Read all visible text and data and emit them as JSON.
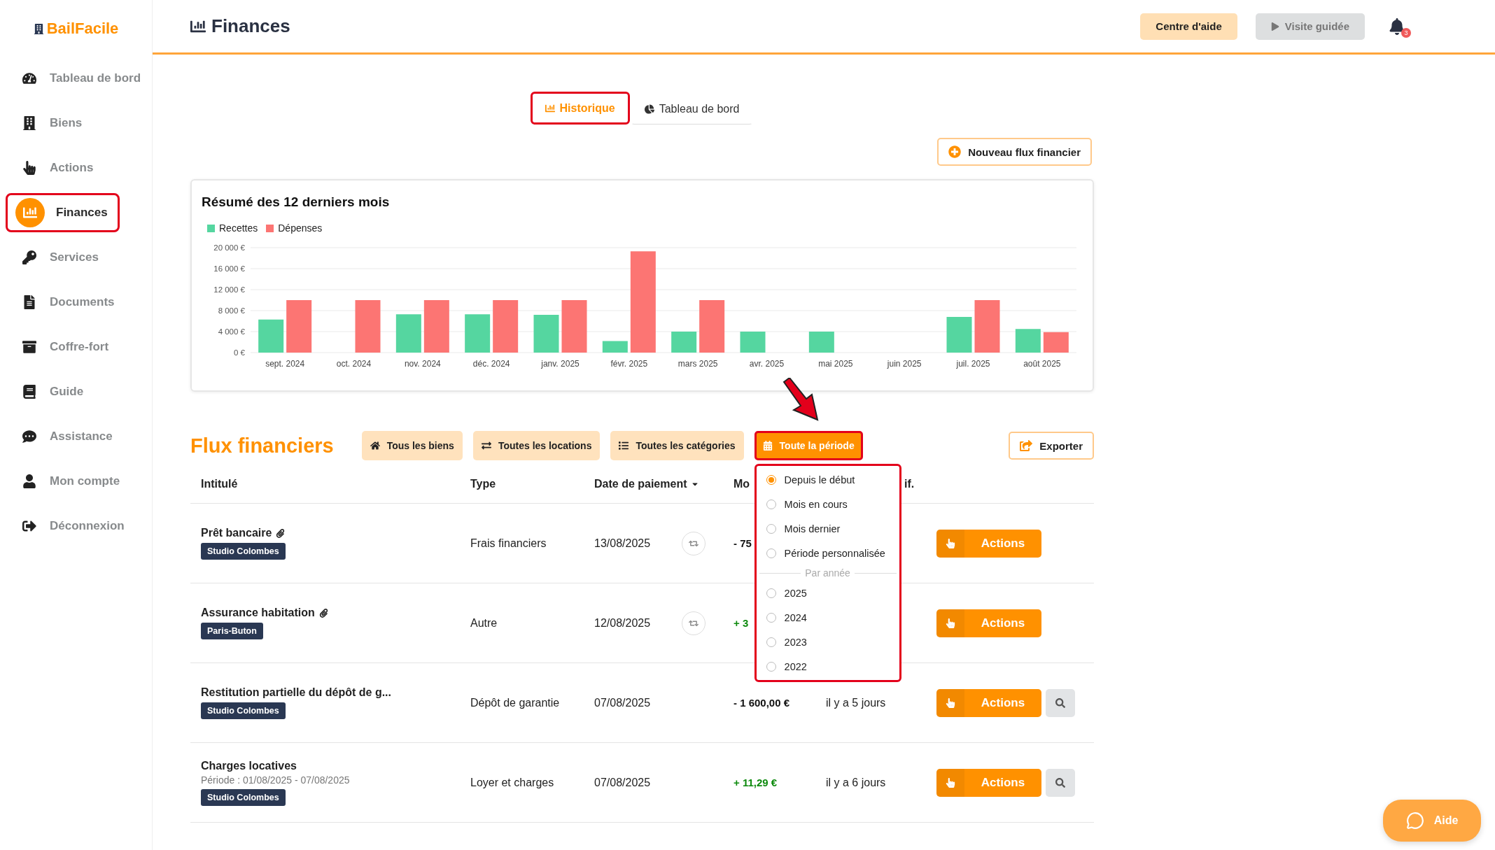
{
  "brand": "BailFacile",
  "sidebar": {
    "items": [
      {
        "label": "Tableau de bord",
        "selected": false,
        "highlighted": false
      },
      {
        "label": "Biens",
        "selected": false,
        "highlighted": false
      },
      {
        "label": "Actions",
        "selected": false,
        "highlighted": false
      },
      {
        "label": "Finances",
        "selected": true,
        "highlighted": true
      },
      {
        "label": "Services",
        "selected": false,
        "highlighted": false
      },
      {
        "label": "Documents",
        "selected": false,
        "highlighted": false
      },
      {
        "label": "Coffre-fort",
        "selected": false,
        "highlighted": false
      },
      {
        "label": "Guide",
        "selected": false,
        "highlighted": false
      },
      {
        "label": "Assistance",
        "selected": false,
        "highlighted": false
      },
      {
        "label": "Mon compte",
        "selected": false,
        "highlighted": false
      },
      {
        "label": "Déconnexion",
        "selected": false,
        "highlighted": false
      }
    ]
  },
  "header": {
    "title": "Finances",
    "buttons": [
      {
        "label": "Centre d'aide",
        "kind": "help"
      },
      {
        "label": "Visite guidée",
        "kind": "tour"
      }
    ],
    "notifications": "3"
  },
  "tabs": [
    {
      "label": "Historique",
      "selected": true,
      "highlighted": true
    },
    {
      "label": "Tableau de bord",
      "selected": false,
      "highlighted": false
    }
  ],
  "new_flow_button": "Nouveau flux financier",
  "summary": {
    "title": "Résumé des 12 derniers mois",
    "chart_data": {
      "type": "bar",
      "categories": [
        "sept. 2024",
        "oct. 2024",
        "nov. 2024",
        "déc. 2024",
        "janv. 2025",
        "févr. 2025",
        "mars 2025",
        "avr. 2025",
        "mai 2025",
        "juin 2025",
        "juil. 2025",
        "août 2025"
      ],
      "series": [
        {
          "name": "Recettes",
          "color": "#55d6a0",
          "values": [
            6300,
            0,
            7300,
            7300,
            7200,
            2200,
            4000,
            4000,
            4000,
            0,
            6800,
            4500
          ]
        },
        {
          "name": "Dépenses",
          "color": "#fc7573",
          "values": [
            10000,
            10000,
            10000,
            10000,
            10000,
            19300,
            10000,
            0,
            0,
            0,
            10000,
            3900
          ]
        }
      ],
      "ylim": [
        0,
        20000
      ],
      "grid": true,
      "yticks": [
        {
          "value": 0,
          "label": "0 €"
        },
        {
          "value": 4000,
          "label": "4 000 €"
        },
        {
          "value": 8000,
          "label": "8 000 €"
        },
        {
          "value": 12000,
          "label": "12 000 €"
        },
        {
          "value": 16000,
          "label": "16 000 €"
        },
        {
          "value": 20000,
          "label": "20 000 €"
        }
      ]
    }
  },
  "flows": {
    "title": "Flux financiers",
    "filters": [
      {
        "label": "Tous les biens",
        "selected": false,
        "highlighted": false
      },
      {
        "label": "Toutes les locations",
        "selected": false,
        "highlighted": false
      },
      {
        "label": "Toutes les catégories",
        "selected": false,
        "highlighted": false
      },
      {
        "label": "Toute la période",
        "selected": true,
        "highlighted": true
      }
    ],
    "export": "Exporter",
    "period_menu": {
      "highlighted": true,
      "options": [
        {
          "label": "Depuis le début",
          "selected": true
        },
        {
          "label": "Mois en cours",
          "selected": false
        },
        {
          "label": "Mois dernier",
          "selected": false
        },
        {
          "label": "Période personnalisée",
          "selected": false
        }
      ],
      "section": "Par année",
      "year_options": [
        {
          "label": "2025",
          "selected": false
        },
        {
          "label": "2024",
          "selected": false
        },
        {
          "label": "2023",
          "selected": false
        },
        {
          "label": "2022",
          "selected": false
        }
      ]
    },
    "columns": [
      {
        "label": "Intitulé",
        "sorted": false
      },
      {
        "label": "Type",
        "sorted": false
      },
      {
        "label": "Date de paiement",
        "sorted": true
      },
      {
        "label": "Mo"
      },
      {
        "label": "if."
      }
    ],
    "rows": [
      {
        "title": "Prêt bancaire",
        "attachment": true,
        "tag": "Studio Colombes",
        "type": "Frais financiers",
        "date": "13/08/2025",
        "recurring": true,
        "amount": "- 75",
        "kind": "debit",
        "action": "Actions",
        "search": false
      },
      {
        "title": "Assurance habitation",
        "attachment": true,
        "tag": "Paris-Buton",
        "type": "Autre",
        "date": "12/08/2025",
        "recurring": true,
        "amount": "+ 3",
        "kind": "credit",
        "action": "Actions",
        "search": false
      },
      {
        "title": "Restitution partielle du dépôt de g...",
        "attachment": false,
        "tag": "Studio Colombes",
        "type": "Dépôt de garantie",
        "date": "07/08/2025",
        "recurring": false,
        "amount": "- 1 600,00 €",
        "kind": "debit",
        "modified": "il y a 5 jours",
        "action": "Actions",
        "search": true
      },
      {
        "title": "Charges locatives",
        "attachment": false,
        "period": "Période : 01/08/2025 - 07/08/2025",
        "tag": "Studio Colombes",
        "type": "Loyer et charges",
        "date": "07/08/2025",
        "recurring": false,
        "amount": "+ 11,29 €",
        "kind": "credit",
        "modified": "il y a 6 jours",
        "action": "Actions",
        "search": true
      }
    ]
  },
  "help_chat": "Aide"
}
